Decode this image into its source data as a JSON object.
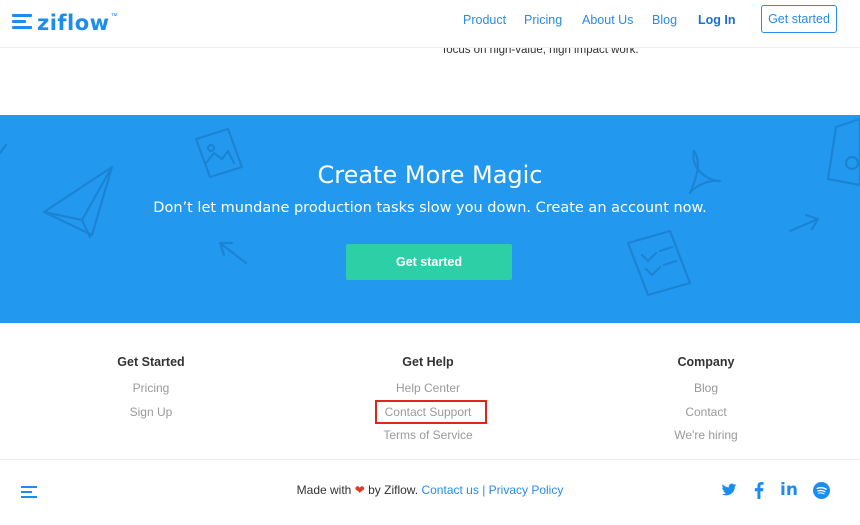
{
  "header": {
    "logo_text": "ziflow",
    "logo_tm": "™",
    "nav": [
      "Product",
      "Pricing",
      "About Us",
      "Blog"
    ],
    "login_label": "Log In",
    "cta_label": "Get started"
  },
  "content": {
    "partial_text": "focus on high-value, high impact work."
  },
  "hero": {
    "title": "Create More Magic",
    "subtitle": "Don’t let mundane production tasks slow you down. Create an account now.",
    "button_label": "Get started",
    "background_color": "#2299ee",
    "button_color": "#2dd0a6"
  },
  "footer": {
    "columns": [
      {
        "heading": "Get Started",
        "links": [
          "Pricing",
          "Sign Up"
        ]
      },
      {
        "heading": "Get Help",
        "links": [
          "Help Center",
          "Contact Support",
          "Terms of Service"
        ]
      },
      {
        "heading": "Company",
        "links": [
          "Blog",
          "Contact",
          "We're hiring"
        ]
      }
    ],
    "bottom": {
      "made_with": "Made with",
      "heart": "❤",
      "by": "by Ziflow.",
      "contact_link": "Contact us",
      "separator": "|",
      "privacy_link": "Privacy Policy"
    },
    "social": [
      "twitter-icon",
      "facebook-icon",
      "linkedin-icon",
      "spotify-icon"
    ],
    "social_labels": {
      "linkedin": "in"
    }
  },
  "colors": {
    "brand_blue": "#1d8cf0",
    "highlight_red": "#e0261b"
  }
}
